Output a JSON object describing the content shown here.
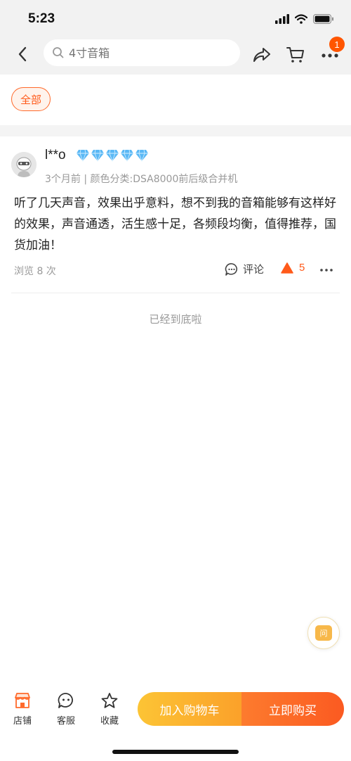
{
  "status_bar": {
    "time": "5:23"
  },
  "nav": {
    "search_placeholder": "4寸音箱",
    "cart_badge": "1"
  },
  "filter": {
    "chip_label": "全部"
  },
  "review": {
    "username": "l**o",
    "meta": "3个月前 | 颜色分类:DSA8000前后级合并机",
    "text": "听了几天声音，效果出乎意料，想不到我的音箱能够有这样好的效果，声音通透，活生感十足，各频段均衡，值得推荐，国货加油！",
    "views": "浏览 8 次",
    "comment_label": "评论",
    "like_count": "5"
  },
  "end_text": "已经到底啦",
  "float_ask": {
    "label": "问"
  },
  "bottom_bar": {
    "shop_label": "店铺",
    "service_label": "客服",
    "favorite_label": "收藏",
    "add_to_cart_label": "加入购物车",
    "buy_now_label": "立即购买"
  },
  "colors": {
    "accent": "#ff5a1a",
    "diamond": "#5ab8f5",
    "cart_gradient_start": "#fcc435",
    "buy_gradient_end": "#fb5a21"
  }
}
